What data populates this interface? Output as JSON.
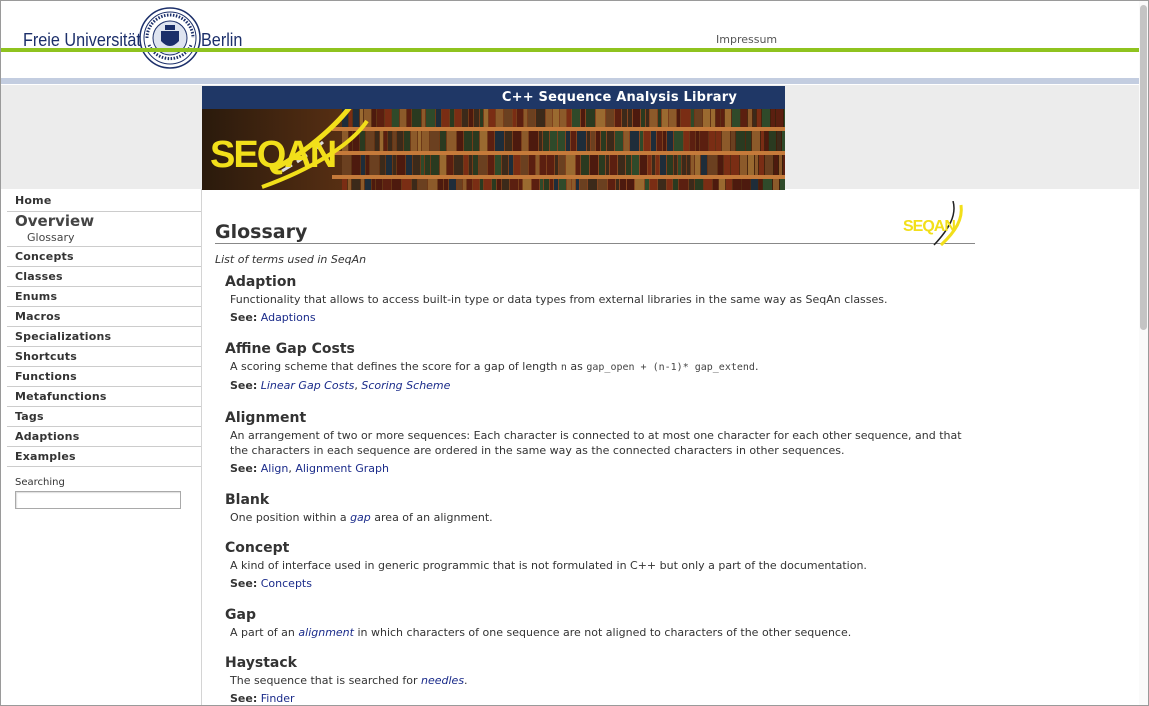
{
  "header": {
    "university_left": "Freie Universität",
    "university_right": "Berlin",
    "impressum": "Impressum"
  },
  "banner": {
    "title": "C++ Sequence Analysis Library",
    "logo_text": "SEQAN"
  },
  "sidebar": {
    "home": "Home",
    "overview": "Overview",
    "glossary": "Glossary",
    "items": [
      "Concepts",
      "Classes",
      "Enums",
      "Macros",
      "Specializations",
      "Shortcuts",
      "Functions",
      "Metafunctions",
      "Tags",
      "Adaptions",
      "Examples"
    ],
    "search_label": "Searching",
    "search_value": ""
  },
  "content": {
    "title": "Glossary",
    "subtitle": "List of terms used in SeqAn",
    "see_label": "See:",
    "entries": [
      {
        "term": "Adaption",
        "definition": "Functionality that allows to access built-in type or data types from external libraries in the same way as SeqAn classes.",
        "see": [
          "Adaptions"
        ]
      },
      {
        "term": "Affine Gap Costs",
        "def_parts": [
          "A scoring scheme that defines the score for a gap of length ",
          "n",
          " as ",
          "gap_open + (n-1)* gap_extend",
          "."
        ],
        "see": [
          "Linear Gap Costs",
          "Scoring Scheme"
        ]
      },
      {
        "term": "Alignment",
        "definition": "An arrangement of two or more sequences: Each character is connected to at most one character for each other sequence, and that the characters in each sequence are ordered in the same way as the connected characters in other sequences.",
        "see": [
          "Align",
          "Alignment Graph"
        ]
      },
      {
        "term": "Blank",
        "def_parts": [
          "One position within a ",
          "gap",
          " area of an alignment."
        ]
      },
      {
        "term": "Concept",
        "definition": "A kind of interface used in generic programmic that is not formulated in C++ but only a part of the documentation.",
        "see": [
          "Concepts"
        ]
      },
      {
        "term": "Gap",
        "def_parts": [
          "A part of an ",
          "alignment",
          " in which characters of one sequence are not aligned to characters of the other sequence."
        ]
      },
      {
        "term": "Haystack",
        "def_parts": [
          "The sequence that is searched for ",
          "needles",
          "."
        ],
        "see": [
          "Finder"
        ]
      }
    ]
  },
  "colors": {
    "green_rule": "#8fc31f",
    "banner_navy": "#1f3766",
    "link": "#1a2b8a",
    "logo_yellow": "#f2df1a"
  }
}
